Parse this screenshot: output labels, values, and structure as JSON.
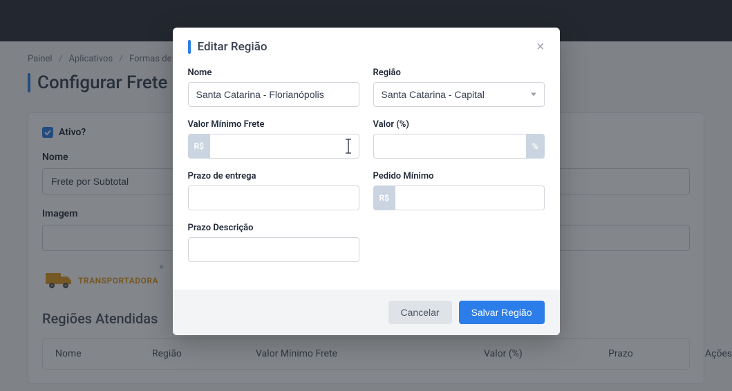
{
  "breadcrumb": {
    "items": [
      "Painel",
      "Aplicativos",
      "Formas de Envio"
    ]
  },
  "page": {
    "title": "Configurar Frete"
  },
  "form": {
    "ativo_label": "Ativo?",
    "nome_label": "Nome",
    "nome_value": "Frete por Subtotal",
    "imagem_label": "Imagem",
    "transport_text": "TRANSPORTADORA"
  },
  "section": {
    "regioes_heading": "Regiões Atendidas"
  },
  "table": {
    "headers": {
      "nome": "Nome",
      "regiao": "Região",
      "valor_minimo": "Valor Mínimo Frete",
      "valor_pct": "Valor (%)",
      "prazo": "Prazo",
      "acoes": "Ações"
    }
  },
  "modal": {
    "title": "Editar Região",
    "labels": {
      "nome": "Nome",
      "regiao": "Região",
      "valor_minimo": "Valor Mínimo Frete",
      "valor_pct": "Valor (%)",
      "prazo_entrega": "Prazo de entrega",
      "pedido_minimo": "Pedido Mínimo",
      "prazo_descricao": "Prazo Descrição"
    },
    "values": {
      "nome": "Santa Catarina - Florianópolis",
      "regiao": "Santa Catarina - Capital"
    },
    "affixes": {
      "rs": "R$",
      "pct": "%"
    },
    "buttons": {
      "cancel": "Cancelar",
      "save": "Salvar Região"
    }
  }
}
